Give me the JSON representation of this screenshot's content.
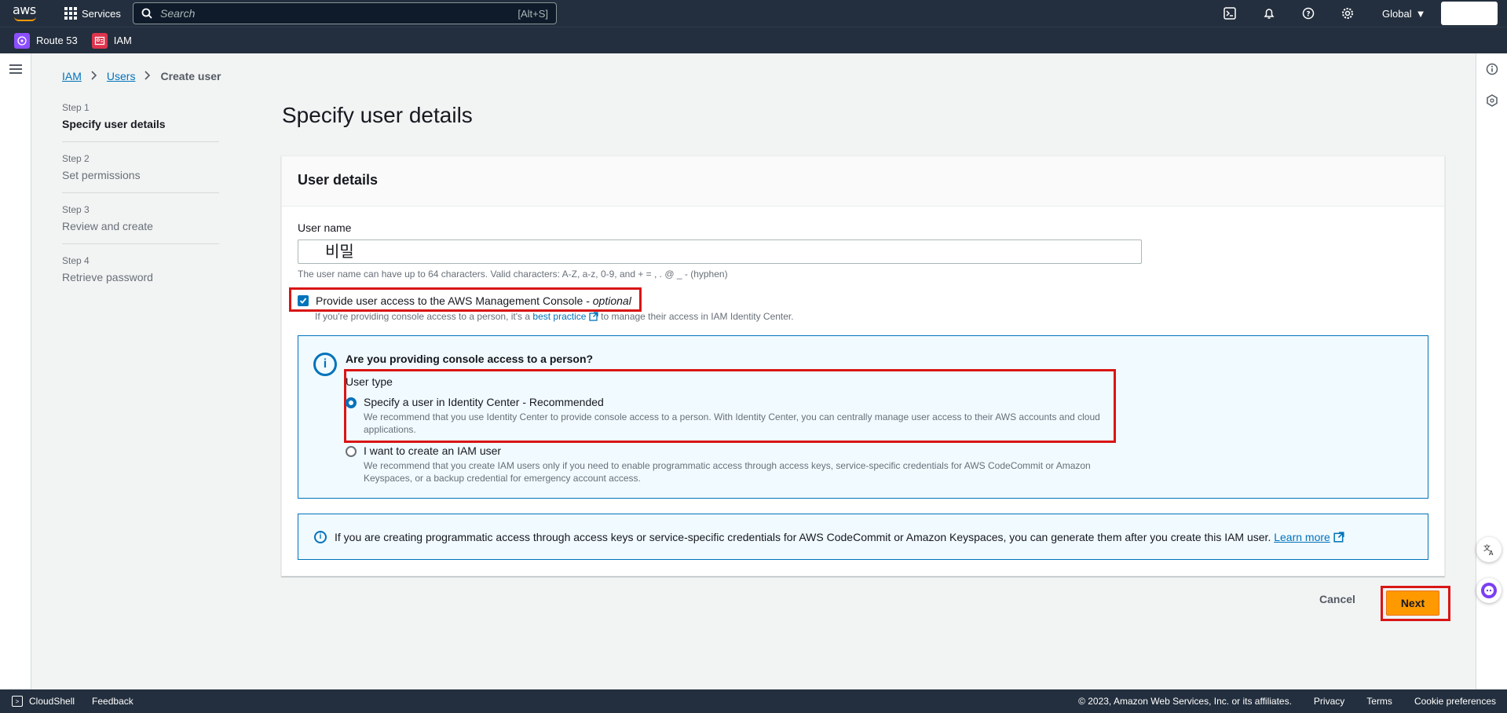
{
  "topnav": {
    "logo_text": "aws",
    "services_label": "Services",
    "search_placeholder": "Search",
    "search_shortcut": "[Alt+S]",
    "region_label": "Global"
  },
  "favorites": [
    {
      "label": "Route 53",
      "color": "#8c4fff"
    },
    {
      "label": "IAM",
      "color": "#dd344c"
    }
  ],
  "breadcrumb": {
    "items": [
      "IAM",
      "Users"
    ],
    "separator": ">",
    "current": "Create user"
  },
  "steps": [
    {
      "num": "Step 1",
      "label": "Specify user details",
      "active": true
    },
    {
      "num": "Step 2",
      "label": "Set permissions",
      "active": false
    },
    {
      "num": "Step 3",
      "label": "Review and create",
      "active": false
    },
    {
      "num": "Step 4",
      "label": "Retrieve password",
      "active": false
    }
  ],
  "page_title": "Specify user details",
  "panel": {
    "header": "User details",
    "user_name_label": "User name",
    "user_name_value": "비밀",
    "user_name_hint": "The user name can have up to 64 characters. Valid characters: A-Z, a-z, 0-9, and + = , . @ _ - (hyphen)",
    "console_access_label": "Provide user access to the AWS Management Console - ",
    "console_access_optional": "optional",
    "console_access_checked": true,
    "console_hint_pre": "If you're providing console access to a person, it's a ",
    "console_hint_link": "best practice",
    "console_hint_post": " to manage their access in IAM Identity Center."
  },
  "info_box": {
    "title": "Are you providing console access to a person?",
    "user_type_label": "User type",
    "options": [
      {
        "title": "Specify a user in Identity Center - Recommended",
        "desc": "We recommend that you use Identity Center to provide console access to a person. With Identity Center, you can centrally manage user access to their AWS accounts and cloud applications.",
        "selected": true
      },
      {
        "title": "I want to create an IAM user",
        "desc": "We recommend that you create IAM users only if you need to enable programmatic access through access keys, service-specific credentials for AWS CodeCommit or Amazon Keyspaces, or a backup credential for emergency account access.",
        "selected": false
      }
    ]
  },
  "note": {
    "text": "If you are creating programmatic access through access keys or service-specific credentials for AWS CodeCommit or Amazon Keyspaces, you can generate them after you create this IAM user.",
    "link": "Learn more"
  },
  "actions": {
    "cancel": "Cancel",
    "next": "Next"
  },
  "footer": {
    "cloudshell": "CloudShell",
    "feedback": "Feedback",
    "copyright": "© 2023, Amazon Web Services, Inc. or its affiliates.",
    "privacy": "Privacy",
    "terms": "Terms",
    "cookies": "Cookie preferences"
  },
  "colors": {
    "nav_bg": "#232f3e",
    "link": "#0073bb",
    "primary_button": "#ff9900",
    "highlight": "#d91515"
  }
}
